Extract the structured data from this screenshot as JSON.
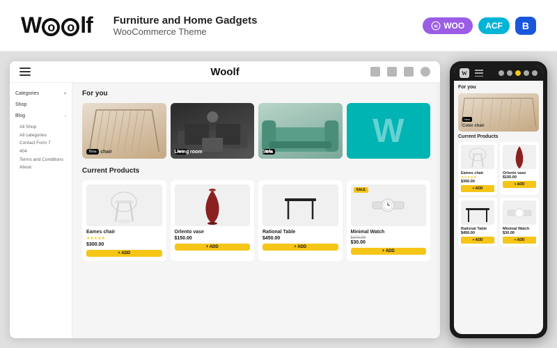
{
  "header": {
    "logo": "Woolf",
    "description_line1": "Furniture and Home Gadgets",
    "description_line2": "WooCommerce Theme",
    "badges": [
      "WOO",
      "ACF",
      "B"
    ]
  },
  "desktop": {
    "topbar": {
      "logo": "Woolf"
    },
    "sidebar": {
      "items": [
        {
          "label": "Categories",
          "hasArrow": true
        },
        {
          "label": "Shop",
          "hasArrow": false
        },
        {
          "label": "Blog",
          "hasArrow": true
        },
        {
          "label": "All Shop"
        },
        {
          "label": "All categories"
        },
        {
          "label": "Contact Form 7"
        },
        {
          "label": "404"
        },
        {
          "label": "Terms and Conditions"
        },
        {
          "label": "About"
        }
      ]
    },
    "for_you": {
      "section_title": "For you",
      "cards": [
        {
          "label": "Color chair",
          "badge": "New",
          "style": "chair"
        },
        {
          "label": "Living room",
          "badge": "New",
          "style": "living"
        },
        {
          "label": "Sofa",
          "badge": "New",
          "style": "sofa"
        },
        {
          "label": "",
          "badge": "",
          "style": "w"
        }
      ]
    },
    "products": {
      "section_title": "Current Products",
      "items": [
        {
          "name": "Eames chair",
          "price": "$300.00",
          "price_old": "",
          "stars": "★★★★★",
          "badge": "",
          "add_label": "+ ADD",
          "style": "chair"
        },
        {
          "name": "Orlento vase",
          "price": "$150.00",
          "price_old": "",
          "stars": "",
          "badge": "",
          "add_label": "+ ADD",
          "style": "vase"
        },
        {
          "name": "Rational Table",
          "price": "$450.00",
          "price_old": "",
          "stars": "",
          "badge": "",
          "add_label": "+ ADD",
          "style": "table"
        },
        {
          "name": "Minimal Watch",
          "price": "$30.00",
          "price_old": "$100.00",
          "stars": "",
          "badge": "SALE",
          "add_label": "+ ADD",
          "style": "watch"
        }
      ]
    }
  },
  "mobile": {
    "for_you_title": "For you",
    "hero_label": "Color chair",
    "hero_badge": "New",
    "current_title": "Current Products",
    "products": [
      {
        "name": "Eames chair",
        "price": "$300.00",
        "stars": "★★★★★",
        "add_label": "+ ADD",
        "style": "chair"
      },
      {
        "name": "Orlento vase",
        "price": "$150.00",
        "stars": "",
        "add_label": "+ ADD",
        "style": "vase"
      },
      {
        "name": "Rational Table",
        "price": "$450.00",
        "stars": "",
        "add_label": "+ ADD",
        "style": "table"
      },
      {
        "name": "Minimal Watch",
        "price": "$30.00",
        "stars": "",
        "add_label": "+ ADD",
        "style": "watch"
      }
    ]
  }
}
